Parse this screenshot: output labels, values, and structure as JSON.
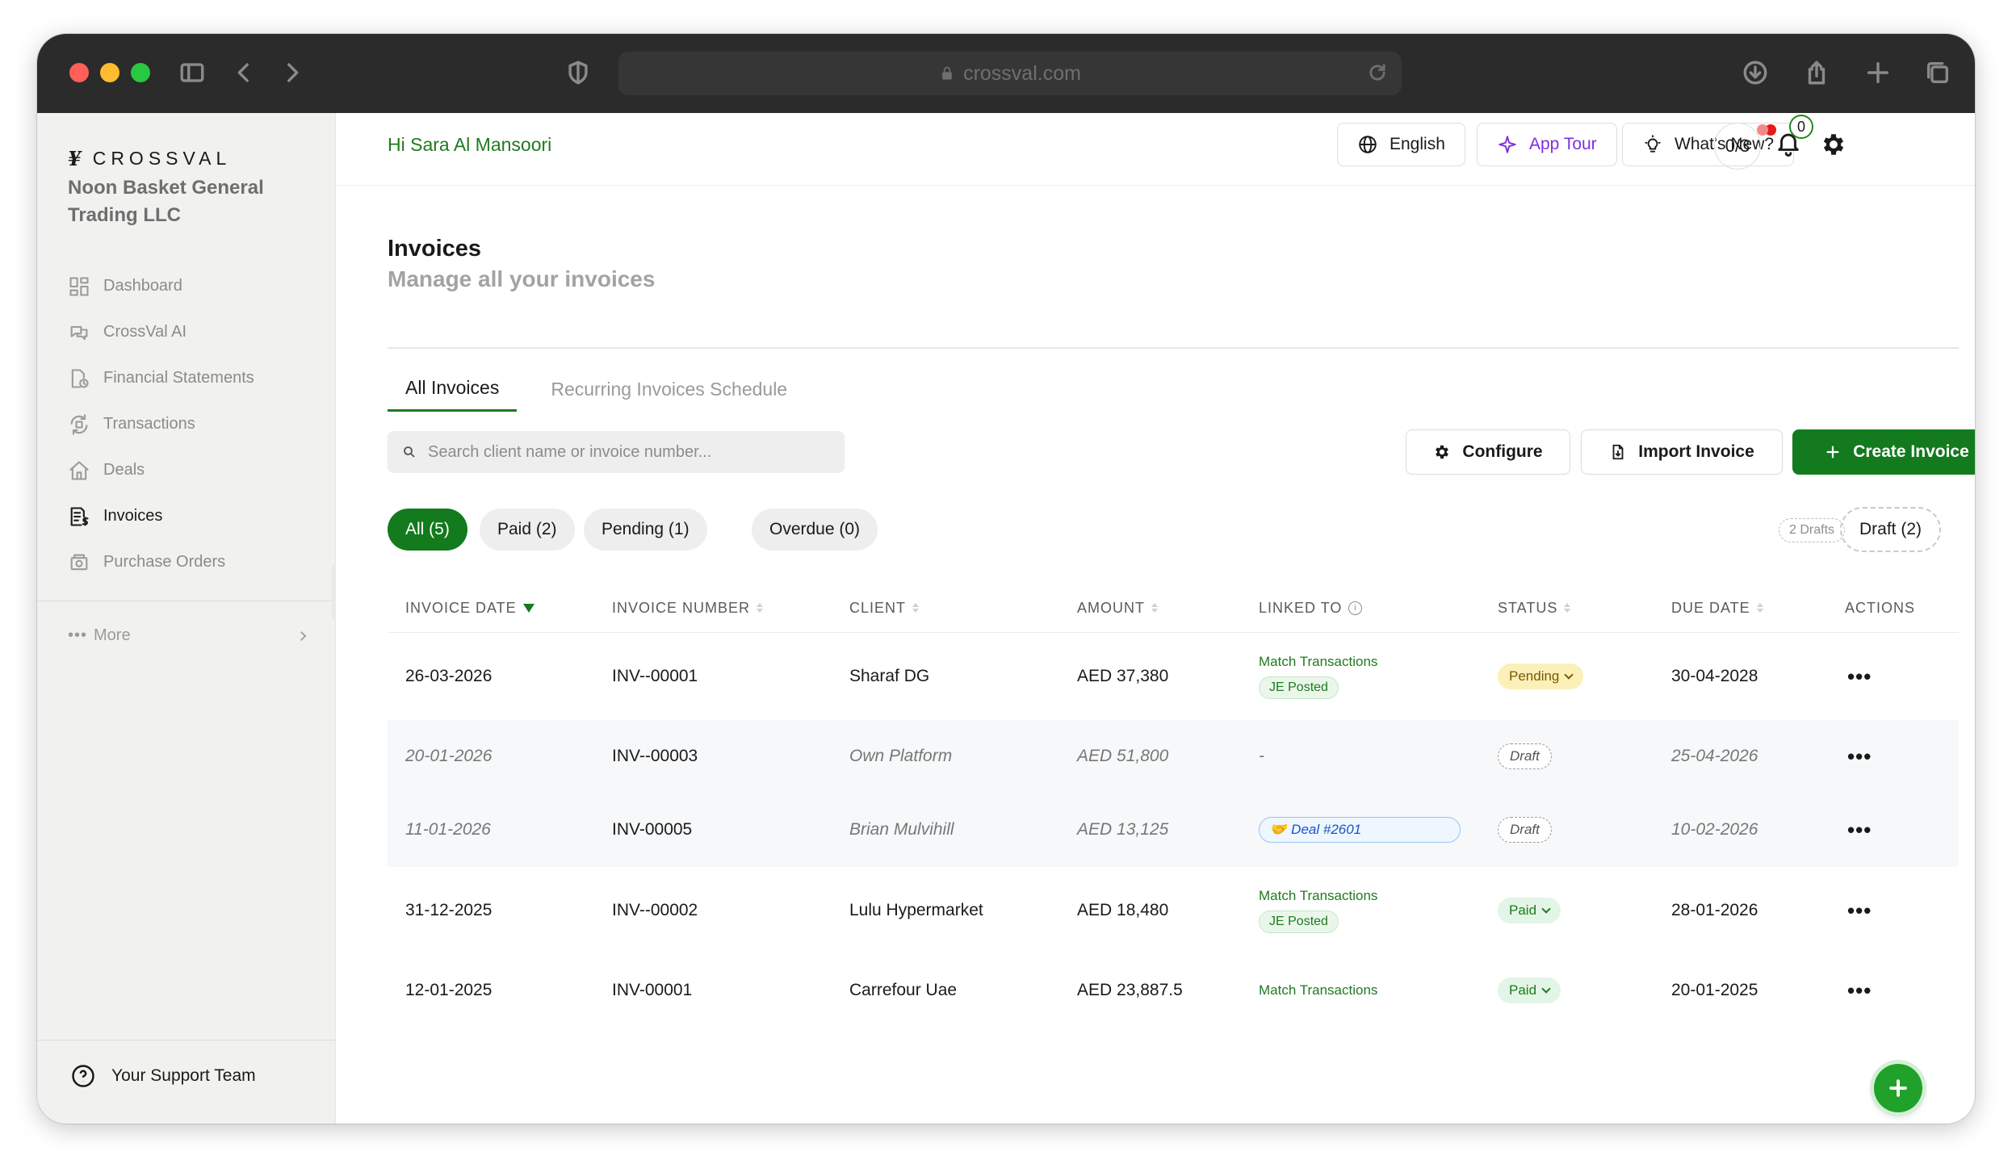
{
  "browser": {
    "url": "crossval.com"
  },
  "sidebar": {
    "logo_text": "CROSSVAL",
    "company_name": "Noon Basket General Trading LLC",
    "items": [
      {
        "label": "Dashboard",
        "icon": "dashboard-icon"
      },
      {
        "label": "CrossVal AI",
        "icon": "chat-ai-icon"
      },
      {
        "label": "Financial Statements",
        "icon": "document-clock-icon"
      },
      {
        "label": "Transactions",
        "icon": "transactions-icon"
      },
      {
        "label": "Deals",
        "icon": "home-icon"
      },
      {
        "label": "Invoices",
        "icon": "invoice-icon",
        "active": true
      },
      {
        "label": "Purchase Orders",
        "icon": "purchase-order-icon"
      }
    ],
    "more_label": "More",
    "support_label": "Your Support Team"
  },
  "topbar": {
    "greeting": "Hi Sara Al Mansoori",
    "language": "English",
    "app_tour": "App Tour",
    "whats_new": "What's New?",
    "progress": "0/3",
    "notifications_count": "0"
  },
  "page": {
    "title": "Invoices",
    "subtitle": "Manage all your invoices"
  },
  "tabs": [
    {
      "label": "All Invoices",
      "active": true
    },
    {
      "label": "Recurring Invoices Schedule",
      "active": false
    }
  ],
  "search": {
    "placeholder": "Search client name or invoice number..."
  },
  "actions": {
    "configure": "Configure",
    "import": "Import Invoice",
    "create": "Create Invoice"
  },
  "filters": [
    {
      "label": "All (5)",
      "active": true
    },
    {
      "label": "Paid (2)",
      "active": false
    },
    {
      "label": "Pending (1)",
      "active": false
    },
    {
      "label": "Overdue (0)",
      "active": false
    }
  ],
  "drafts": {
    "tag": "2 Drafts",
    "button": "Draft (2)"
  },
  "table": {
    "columns": [
      "INVOICE DATE",
      "INVOICE NUMBER",
      "CLIENT",
      "AMOUNT",
      "LINKED TO",
      "STATUS",
      "DUE DATE",
      "ACTIONS"
    ],
    "rows": [
      {
        "date": "26-03-2026",
        "number": "INV--00001",
        "client": "Sharaf DG",
        "amount": "AED 37,380",
        "linked_match": "Match Transactions",
        "linked_je": "JE Posted",
        "status": "Pending",
        "due": "30-04-2028"
      },
      {
        "date": "20-01-2026",
        "number": "INV--00003",
        "client": "Own Platform",
        "amount": "AED 51,800",
        "linked_text": "-",
        "status": "Draft",
        "due": "25-04-2026"
      },
      {
        "date": "11-01-2026",
        "number": "INV-00005",
        "client": "Brian Mulvihill",
        "amount": "AED 13,125",
        "linked_deal": "Deal #2601",
        "status": "Draft",
        "due": "10-02-2026"
      },
      {
        "date": "31-12-2025",
        "number": "INV--00002",
        "client": "Lulu Hypermarket",
        "amount": "AED 18,480",
        "linked_match": "Match Transactions",
        "linked_je": "JE Posted",
        "status": "Paid",
        "due": "28-01-2026"
      },
      {
        "date": "12-01-2025",
        "number": "INV-00001",
        "client": "Carrefour Uae",
        "amount": "AED 23,887.5",
        "linked_match": "Match Transactions",
        "status": "Paid",
        "due": "20-01-2025"
      }
    ],
    "actions_glyph": "•••"
  },
  "colors": {
    "brand_green": "#137a1d",
    "pending": "#fbf0b8",
    "paid": "#e3f5e6",
    "tour_purple": "#7e2fe0"
  }
}
